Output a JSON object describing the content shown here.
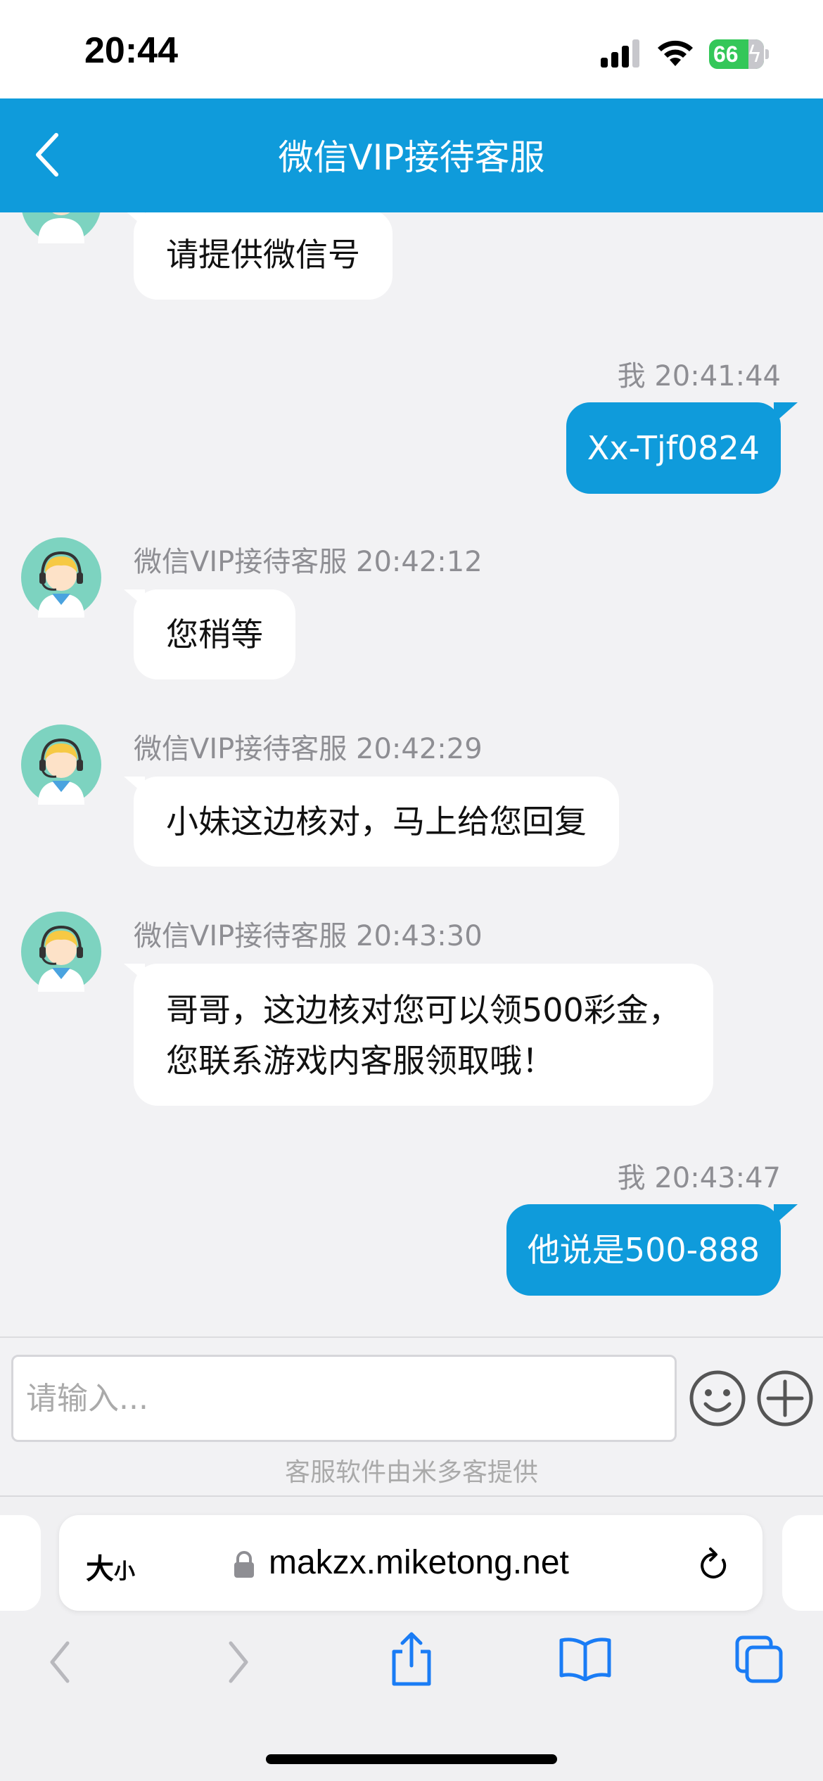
{
  "status_bar": {
    "time": "20:44",
    "battery": "66"
  },
  "header": {
    "title": "微信VIP接待客服"
  },
  "messages": [
    {
      "sender": "agent",
      "meta": "",
      "text": "请提供微信号"
    },
    {
      "sender": "me",
      "meta": "我 20:41:44",
      "text": "Xx-Tjf0824"
    },
    {
      "sender": "agent",
      "meta": "微信VIP接待客服 20:42:12",
      "text": "您稍等"
    },
    {
      "sender": "agent",
      "meta": "微信VIP接待客服 20:42:29",
      "text": "小妹这边核对，马上给您回复"
    },
    {
      "sender": "agent",
      "meta": "微信VIP接待客服 20:43:30",
      "lines": [
        "哥哥，这边核对您可以领500彩金，",
        "您联系游戏内客服领取哦！"
      ]
    },
    {
      "sender": "me",
      "meta": "我 20:43:47",
      "text": "他说是500-888"
    }
  ],
  "input": {
    "placeholder": "请输入...",
    "powered_by": "客服软件由米多客提供"
  },
  "browser": {
    "aa_label_big": "大",
    "aa_label_small": "小",
    "url": "makzx.miketong.net"
  },
  "colors": {
    "brand": "#0f9bdb",
    "battery": "#34c759"
  },
  "icons": [
    "back-icon",
    "signal-icon",
    "wifi-icon",
    "emoji-icon",
    "plus-icon",
    "lock-icon",
    "reload-icon",
    "nav-back-icon",
    "nav-forward-icon",
    "share-icon",
    "bookmarks-icon",
    "tabs-icon"
  ]
}
